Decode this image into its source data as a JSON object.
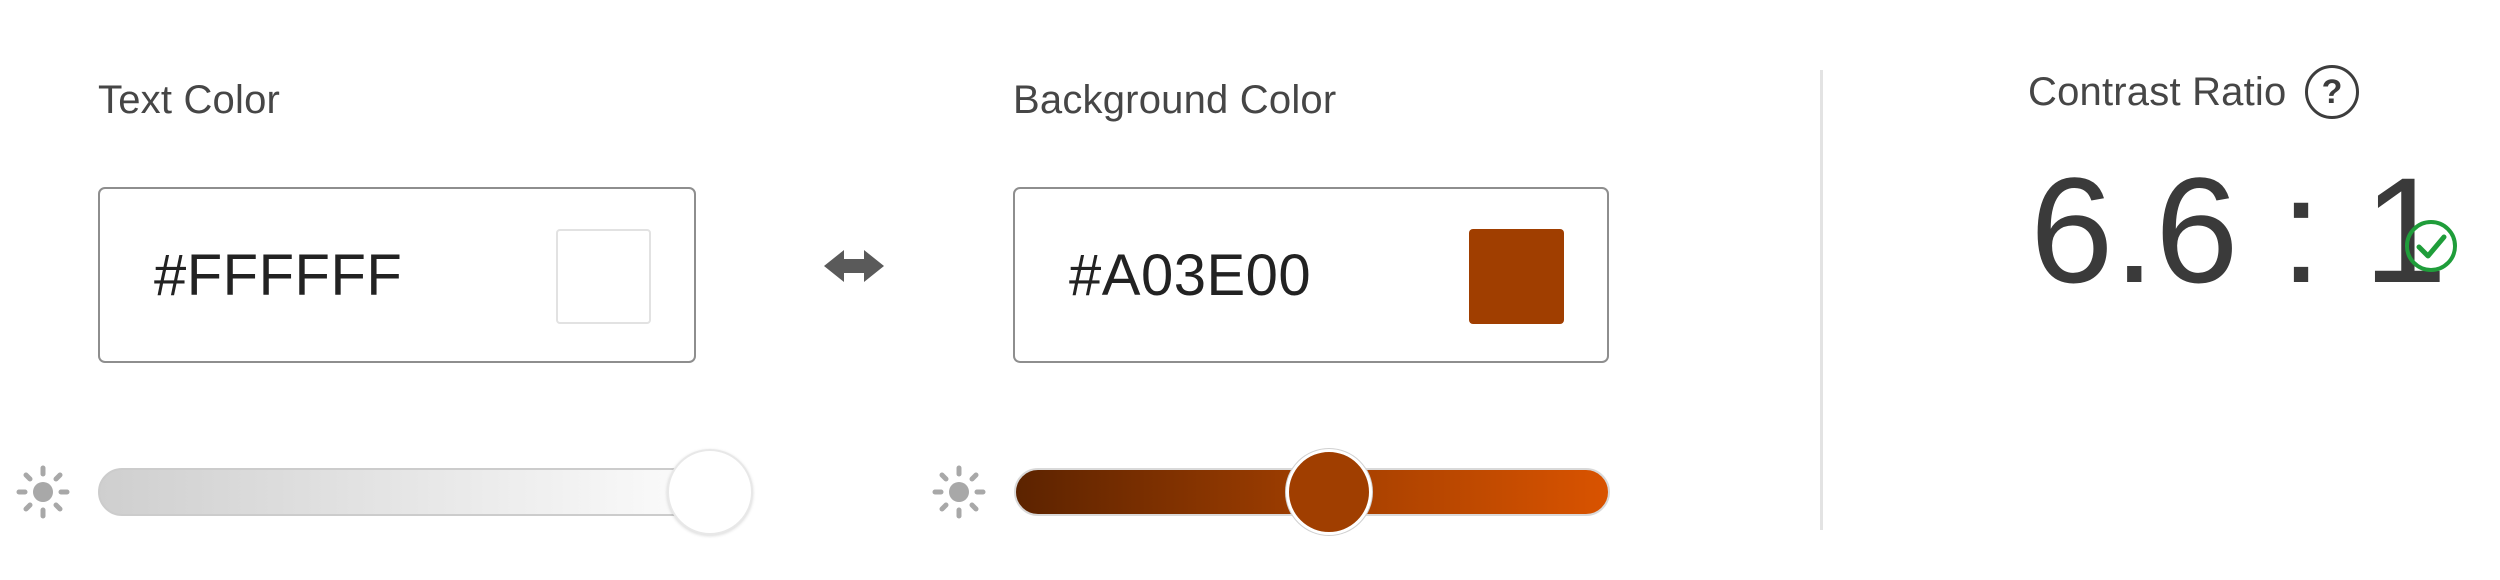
{
  "text_color": {
    "label": "Text Color",
    "value": "#FFFFFF",
    "swatch_color": "#FFFFFF",
    "brightness_level": 1.0,
    "icon": "brightness-icon"
  },
  "swap": {
    "icon": "swap-arrows-icon"
  },
  "background_color": {
    "label": "Background Color",
    "value": "#A03E00",
    "swatch_color": "#A03E00",
    "brightness_level": 0.5,
    "icon": "brightness-icon"
  },
  "contrast": {
    "label": "Contrast Ratio",
    "help_symbol": "?",
    "value": "6.6 : 1",
    "status_icon": "check-circle-icon",
    "status_color": "#1f9d3a"
  },
  "colors": {
    "text_track_start": "#cfcfcf",
    "text_track_end": "#ffffff",
    "bg_track_start": "#5c2300",
    "bg_track_end": "#d95300"
  }
}
